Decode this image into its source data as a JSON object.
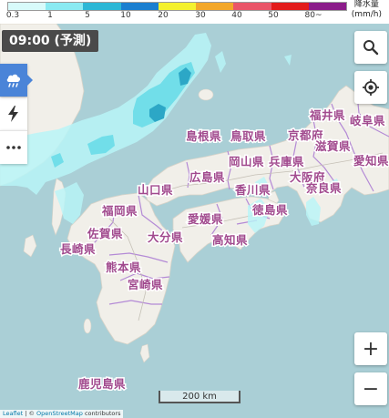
{
  "legend": {
    "colors": [
      "#d8fbfb",
      "#8aeaf2",
      "#2bb7d6",
      "#1a7fd0",
      "#f4f12e",
      "#f3a729",
      "#ea5568",
      "#e31b1b",
      "#8b1c8a"
    ],
    "ticks": [
      "0.3",
      "1",
      "5",
      "10",
      "20",
      "30",
      "40",
      "50",
      "80~"
    ],
    "unit_title": "降水量",
    "unit": "(mm/h)"
  },
  "time_badge": "09:00 (予測)",
  "left_panel": {
    "items": [
      {
        "icon": "rain-cloud-icon",
        "active": true
      },
      {
        "icon": "lightning-icon",
        "active": false
      },
      {
        "icon": "more-dots-icon",
        "active": false
      }
    ]
  },
  "controls": {
    "search_icon": "search-icon",
    "locate_icon": "locate-icon",
    "zoom_in": "+",
    "zoom_out": "−"
  },
  "map": {
    "prefectures": [
      "福井県",
      "岐阜県",
      "島根県",
      "鳥取県",
      "京都府",
      "滋賀県",
      "愛知県",
      "岡山県",
      "兵庫県",
      "広島県",
      "大阪府",
      "奈良県",
      "山口県",
      "香川県",
      "愛媛県",
      "徳島県",
      "福岡県",
      "高知県",
      "佐賀県",
      "大分県",
      "長崎県",
      "熊本県",
      "宮崎県",
      "鹿児島県"
    ],
    "colors": {
      "sea": "#aacfd6",
      "land": "#f1efe9",
      "rain_light": "#b8f5f7",
      "rain_mid": "#69dce8",
      "rain_heavy": "#2ca7c6",
      "border": "#b48ad6"
    }
  },
  "scale": "200 km",
  "attribution": {
    "leaflet": "Leaflet",
    "separator": " | © ",
    "osm": "OpenStreetMap",
    "rest": " contributors"
  }
}
